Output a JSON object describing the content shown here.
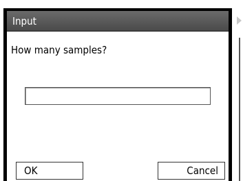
{
  "dialog": {
    "title": "Input",
    "prompt": "How many samples?",
    "input": {
      "value": "",
      "placeholder": ""
    },
    "buttons": {
      "ok_label": "OK",
      "cancel_label": "Cancel"
    }
  },
  "colors": {
    "title_bar": "#5a5a5a",
    "title_text": "#ffffff",
    "frame": "#000000"
  }
}
